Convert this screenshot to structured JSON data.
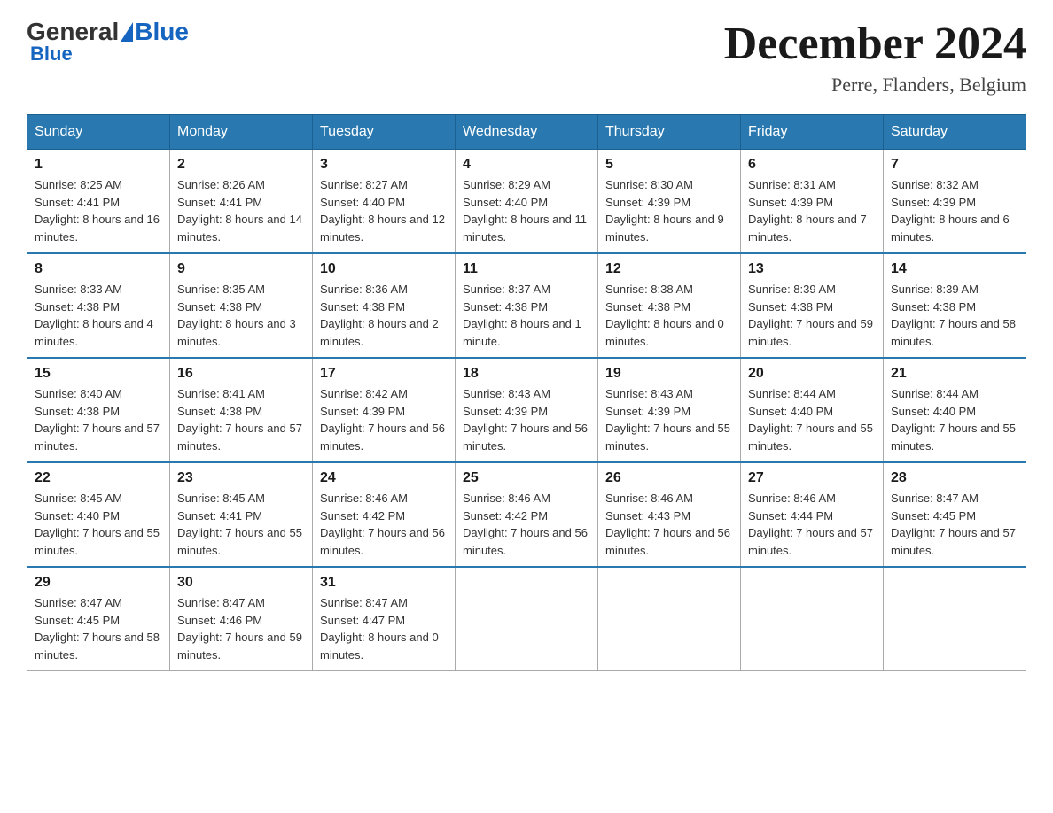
{
  "logo": {
    "general": "General",
    "blue": "Blue"
  },
  "title": "December 2024",
  "subtitle": "Perre, Flanders, Belgium",
  "days_of_week": [
    "Sunday",
    "Monday",
    "Tuesday",
    "Wednesday",
    "Thursday",
    "Friday",
    "Saturday"
  ],
  "weeks": [
    [
      {
        "day": "1",
        "sunrise": "8:25 AM",
        "sunset": "4:41 PM",
        "daylight": "8 hours and 16 minutes."
      },
      {
        "day": "2",
        "sunrise": "8:26 AM",
        "sunset": "4:41 PM",
        "daylight": "8 hours and 14 minutes."
      },
      {
        "day": "3",
        "sunrise": "8:27 AM",
        "sunset": "4:40 PM",
        "daylight": "8 hours and 12 minutes."
      },
      {
        "day": "4",
        "sunrise": "8:29 AM",
        "sunset": "4:40 PM",
        "daylight": "8 hours and 11 minutes."
      },
      {
        "day": "5",
        "sunrise": "8:30 AM",
        "sunset": "4:39 PM",
        "daylight": "8 hours and 9 minutes."
      },
      {
        "day": "6",
        "sunrise": "8:31 AM",
        "sunset": "4:39 PM",
        "daylight": "8 hours and 7 minutes."
      },
      {
        "day": "7",
        "sunrise": "8:32 AM",
        "sunset": "4:39 PM",
        "daylight": "8 hours and 6 minutes."
      }
    ],
    [
      {
        "day": "8",
        "sunrise": "8:33 AM",
        "sunset": "4:38 PM",
        "daylight": "8 hours and 4 minutes."
      },
      {
        "day": "9",
        "sunrise": "8:35 AM",
        "sunset": "4:38 PM",
        "daylight": "8 hours and 3 minutes."
      },
      {
        "day": "10",
        "sunrise": "8:36 AM",
        "sunset": "4:38 PM",
        "daylight": "8 hours and 2 minutes."
      },
      {
        "day": "11",
        "sunrise": "8:37 AM",
        "sunset": "4:38 PM",
        "daylight": "8 hours and 1 minute."
      },
      {
        "day": "12",
        "sunrise": "8:38 AM",
        "sunset": "4:38 PM",
        "daylight": "8 hours and 0 minutes."
      },
      {
        "day": "13",
        "sunrise": "8:39 AM",
        "sunset": "4:38 PM",
        "daylight": "7 hours and 59 minutes."
      },
      {
        "day": "14",
        "sunrise": "8:39 AM",
        "sunset": "4:38 PM",
        "daylight": "7 hours and 58 minutes."
      }
    ],
    [
      {
        "day": "15",
        "sunrise": "8:40 AM",
        "sunset": "4:38 PM",
        "daylight": "7 hours and 57 minutes."
      },
      {
        "day": "16",
        "sunrise": "8:41 AM",
        "sunset": "4:38 PM",
        "daylight": "7 hours and 57 minutes."
      },
      {
        "day": "17",
        "sunrise": "8:42 AM",
        "sunset": "4:39 PM",
        "daylight": "7 hours and 56 minutes."
      },
      {
        "day": "18",
        "sunrise": "8:43 AM",
        "sunset": "4:39 PM",
        "daylight": "7 hours and 56 minutes."
      },
      {
        "day": "19",
        "sunrise": "8:43 AM",
        "sunset": "4:39 PM",
        "daylight": "7 hours and 55 minutes."
      },
      {
        "day": "20",
        "sunrise": "8:44 AM",
        "sunset": "4:40 PM",
        "daylight": "7 hours and 55 minutes."
      },
      {
        "day": "21",
        "sunrise": "8:44 AM",
        "sunset": "4:40 PM",
        "daylight": "7 hours and 55 minutes."
      }
    ],
    [
      {
        "day": "22",
        "sunrise": "8:45 AM",
        "sunset": "4:40 PM",
        "daylight": "7 hours and 55 minutes."
      },
      {
        "day": "23",
        "sunrise": "8:45 AM",
        "sunset": "4:41 PM",
        "daylight": "7 hours and 55 minutes."
      },
      {
        "day": "24",
        "sunrise": "8:46 AM",
        "sunset": "4:42 PM",
        "daylight": "7 hours and 56 minutes."
      },
      {
        "day": "25",
        "sunrise": "8:46 AM",
        "sunset": "4:42 PM",
        "daylight": "7 hours and 56 minutes."
      },
      {
        "day": "26",
        "sunrise": "8:46 AM",
        "sunset": "4:43 PM",
        "daylight": "7 hours and 56 minutes."
      },
      {
        "day": "27",
        "sunrise": "8:46 AM",
        "sunset": "4:44 PM",
        "daylight": "7 hours and 57 minutes."
      },
      {
        "day": "28",
        "sunrise": "8:47 AM",
        "sunset": "4:45 PM",
        "daylight": "7 hours and 57 minutes."
      }
    ],
    [
      {
        "day": "29",
        "sunrise": "8:47 AM",
        "sunset": "4:45 PM",
        "daylight": "7 hours and 58 minutes."
      },
      {
        "day": "30",
        "sunrise": "8:47 AM",
        "sunset": "4:46 PM",
        "daylight": "7 hours and 59 minutes."
      },
      {
        "day": "31",
        "sunrise": "8:47 AM",
        "sunset": "4:47 PM",
        "daylight": "8 hours and 0 minutes."
      },
      null,
      null,
      null,
      null
    ]
  ]
}
